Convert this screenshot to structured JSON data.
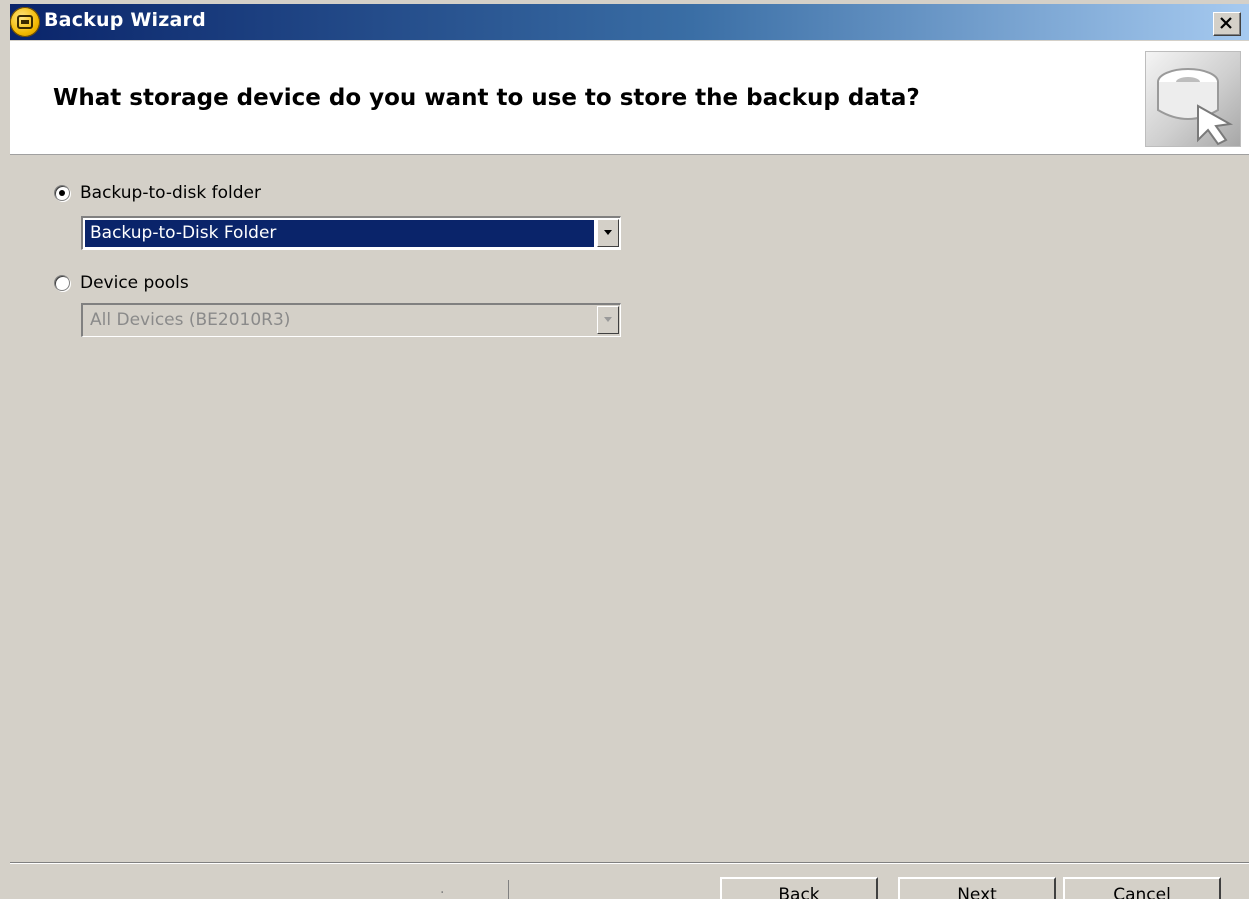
{
  "window": {
    "title": "Backup Wizard",
    "icon": "backup-exec-icon",
    "close_label": "close-icon"
  },
  "header": {
    "question": "What storage device do you want to use to store the backup data?",
    "art_icon": "tape-storage-icon"
  },
  "options": {
    "backup_to_disk": {
      "label": "Backup-to-disk folder",
      "selected": true,
      "combo_value": "Backup-to-Disk Folder"
    },
    "device_pools": {
      "label": "Device pools",
      "selected": false,
      "combo_value": "All Devices (BE2010R3)"
    }
  },
  "footer": {
    "marks": "·",
    "back_label": "Back",
    "next_label": "Next",
    "cancel_label": "Cancel"
  },
  "colors": {
    "titlebar_start": "#0a246a",
    "titlebar_end": "#a6caf0",
    "dialog_bg": "#d4d0c8",
    "selection_bg": "#0a246a"
  }
}
